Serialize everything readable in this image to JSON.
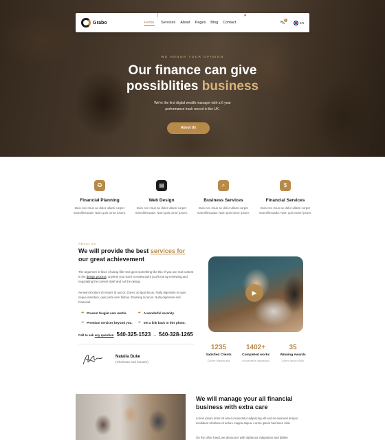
{
  "nav": {
    "logo": "Grabo",
    "links": [
      "Home",
      "Services",
      "About",
      "Pages",
      "Blog",
      "Contact"
    ],
    "cart_count": "0",
    "lang": "EN"
  },
  "hero": {
    "kicker": "WE HONOR YOUR OPINION",
    "title_line1": "Our finance can give",
    "title_line2_plain": "possiblities ",
    "title_line2_accent": "business",
    "subtitle": "We're the first digital wealth manager with a 6 year performance track record in the UK.",
    "button": "About Us"
  },
  "features": [
    {
      "icon": "tie-icon",
      "glyph": "✪",
      "title": "Financial Planning",
      "text": "Duis nec risus ac dolor ullami corper manolliesuada. Nam quis tortor ipsum."
    },
    {
      "icon": "chart-icon",
      "glyph": "▤",
      "title": "Web Design",
      "text": "Duis nec risus ac dolor ullami corper manolliesuada. Nam quis tortor ipsum."
    },
    {
      "icon": "search-icon",
      "glyph": "⌕",
      "title": "Business Services",
      "text": "Duis nec risus ac dolor ullami corper manolliesuada. Nam quis tortor ipsum."
    },
    {
      "icon": "money-bag-icon",
      "glyph": "$",
      "title": "Financial Services",
      "text": "Duis nec risus ac dolor ullami corper manolliesuada. Nam quis tortor ipsum."
    }
  ],
  "about": {
    "kicker": "About us",
    "title_pre": "We will provide the best ",
    "title_link": "services for",
    "title_post": " our great achievement",
    "p1_pre": "The argument in favor of using filler text goes something like this: If you use real content in the ",
    "p1_link": "design process",
    "p1_post": ", anytime you reach a review point you'll end up reviewing and negotiating the content itself and not the design.",
    "p2": "Aenean tincidunt id mauris id auctor. Donec at ligula lacus. Nulla dignissim mi quis neque interdum, quis porta sem finibus. Etiaming la lacus. Nulla dignissim and Financial.",
    "checks": [
      "Prasent feugiat sem mattis.",
      "A wonderful serenity.",
      "Premium services beyond you.",
      "Set a link back to this photo."
    ],
    "call_pre": "Call to ask ",
    "call_link": "any question",
    "phone1": "540-325-1523",
    "or": "or",
    "phone2": "540-328-1265",
    "sig_name": "Natalia Duke",
    "sig_role": "(Chairman and founder)"
  },
  "stats": [
    {
      "value": "1235",
      "label": "Satisfied Clients",
      "sub": "Dolore magna aliq"
    },
    {
      "value": "1402+",
      "label": "Completed works",
      "sub": "consectetur adipiscing"
    },
    {
      "value": "35",
      "label": "Winning Awards",
      "sub": "Lorem ipsum dolor"
    }
  ],
  "manage": {
    "title": "We will manage your all financial business with extra care",
    "p1": "Lorem ipsum dolor sit amet consectetur adipiscing elit sed do eiusmod tempor incididunt ut labore et dolore magna aliqua. Lorem ipsum has been rode",
    "p2": "On the other hand, we denounce with righteous indignation and dislike"
  },
  "colors": {
    "accent": "#b88a4a",
    "dark": "#1b1b1b"
  }
}
